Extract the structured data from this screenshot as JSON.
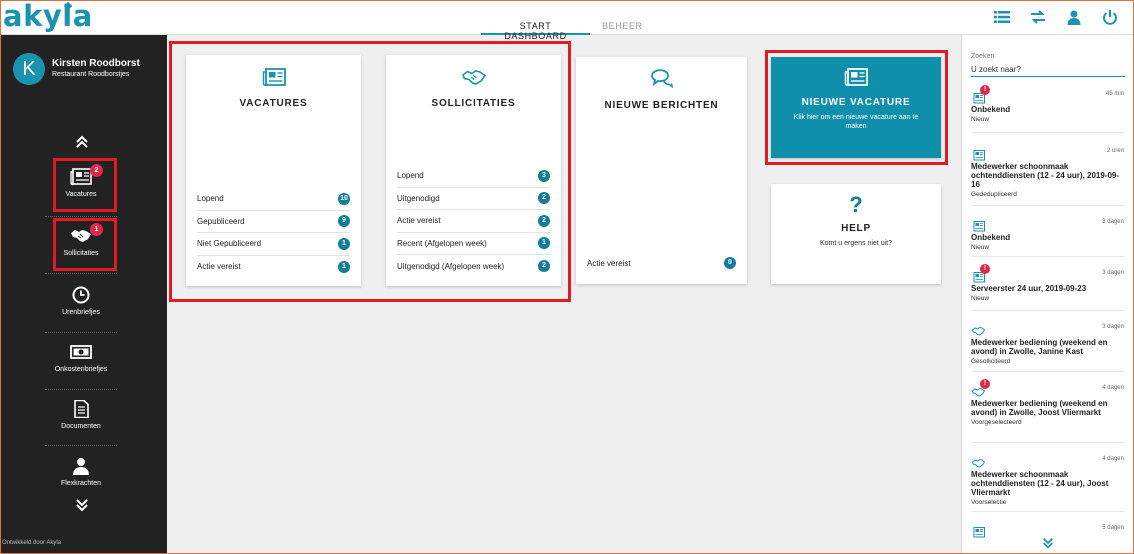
{
  "app": {
    "logo": "akyla"
  },
  "nav": {
    "tabs": [
      {
        "label": "START DASHBOARD",
        "active": true
      },
      {
        "label": "BEHEER",
        "active": false
      }
    ]
  },
  "topicons": [
    "list-icon",
    "transfer-icon",
    "user-icon",
    "power-icon"
  ],
  "user": {
    "initial": "K",
    "name": "Kirsten Roodborst",
    "company": "Restaurant Roodborstjes"
  },
  "sidebar": {
    "items": [
      {
        "label": "Vacatures",
        "badge": "2",
        "icon": "newspaper-icon"
      },
      {
        "label": "Sollicitaties",
        "badge": "1",
        "icon": "handshake-icon"
      },
      {
        "label": "Urenbriefjes",
        "badge": "",
        "icon": "clock-icon"
      },
      {
        "label": "Onkostenbriefjes",
        "badge": "",
        "icon": "money-icon"
      },
      {
        "label": "Documenten",
        "badge": "",
        "icon": "document-icon"
      },
      {
        "label": "Flexkrachten",
        "badge": "",
        "icon": "person-icon"
      }
    ],
    "footer": "Ontwikkeld door Akyla"
  },
  "cards": {
    "vacatures": {
      "title": "VACATURES",
      "rows": [
        {
          "label": "Lopend",
          "count": "10"
        },
        {
          "label": "Gepubliceerd",
          "count": "9"
        },
        {
          "label": "Niet Gepubliceerd",
          "count": "1"
        },
        {
          "label": "Actie vereist",
          "count": "1"
        }
      ]
    },
    "sollicitaties": {
      "title": "SOLLICITATIES",
      "rows": [
        {
          "label": "Lopend",
          "count": "3"
        },
        {
          "label": "Uitgenodigd",
          "count": "2"
        },
        {
          "label": "Actie vereist",
          "count": "2"
        },
        {
          "label": "Recent (Afgelopen week)",
          "count": "1"
        },
        {
          "label": "Uitgenodigd (Afgelopen week)",
          "count": "2"
        }
      ]
    },
    "berichten": {
      "title": "NIEUWE BERICHTEN",
      "rows": [
        {
          "label": "Actie vereist",
          "count": "0"
        }
      ]
    },
    "nieuwe_vacature": {
      "title": "NIEUWE VACATURE",
      "subtitle": "Klik hier om een nieuwe vacature aan te maken",
      "color": "#0f8fab"
    },
    "help": {
      "icon": "?",
      "title": "HELP",
      "subtitle": "Komt u ergens niet uit?"
    }
  },
  "search": {
    "label": "Zoeken",
    "placeholder": "U zoekt naar?"
  },
  "feed": [
    {
      "icon": "newspaper-icon",
      "alert": true,
      "time": "45 min",
      "title": "Onbekend",
      "status": "Nieuw"
    },
    {
      "icon": "newspaper-icon",
      "alert": false,
      "time": "2 uren",
      "title": "Medewerker schoonmaak ochtenddiensten (12 - 24 uur), 2019-09-16",
      "status": "Gededupliceerd"
    },
    {
      "icon": "newspaper-icon",
      "alert": false,
      "time": "3 dagen",
      "title": "Onbekend",
      "status": "Nieuw"
    },
    {
      "icon": "newspaper-icon",
      "alert": true,
      "time": "3 dagen",
      "title": "Serveerster 24 uur, 2019-09-23",
      "status": "Nieuw"
    },
    {
      "icon": "handshake-icon",
      "alert": false,
      "time": "3 dagen",
      "title": "Medewerker bediening (weekend en avond) in Zwolle, Janine Kast",
      "status": "Gesolliciteerd"
    },
    {
      "icon": "handshake-icon",
      "alert": true,
      "time": "4 dagen",
      "title": "Medewerker bediening (weekend en avond) in Zwolle, Joost Vliermarkt",
      "status": "Voorgeselecteerd"
    },
    {
      "icon": "handshake-icon",
      "alert": false,
      "time": "4 dagen",
      "title": "Medewerker schoonmaak ochtenddiensten (12 - 24 uur), Joost Vliermarkt",
      "status": "Voorselectie"
    },
    {
      "icon": "newspaper-icon",
      "alert": false,
      "time": "5 dagen",
      "title": "",
      "status": ""
    }
  ],
  "colors": {
    "accent": "#1a93b0",
    "badge": "#e0284a",
    "highlight": "#e01b24",
    "sidebar": "#222222"
  }
}
